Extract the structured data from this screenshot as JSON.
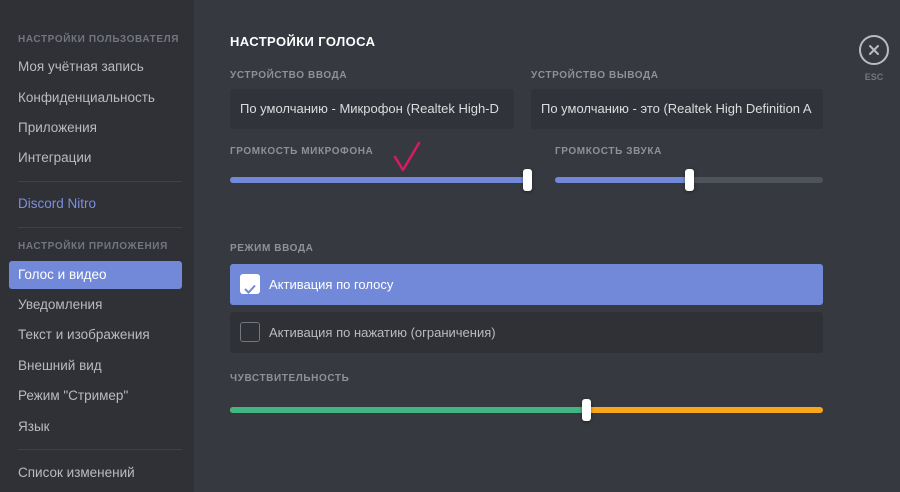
{
  "sidebar": {
    "user_settings_header": "Настройки пользователя",
    "user_items": [
      {
        "label": "Моя учётная запись"
      },
      {
        "label": "Конфиденциальность"
      },
      {
        "label": "Приложения"
      },
      {
        "label": "Интеграции"
      }
    ],
    "nitro_label": "Discord Nitro",
    "app_settings_header": "Настройки приложения",
    "app_items": [
      {
        "label": "Голос и видео",
        "selected": true
      },
      {
        "label": "Уведомления"
      },
      {
        "label": "Текст и изображения"
      },
      {
        "label": "Внешний вид"
      },
      {
        "label": "Режим \"Стример\""
      },
      {
        "label": "Язык"
      }
    ],
    "changelog_label": "Список изменений"
  },
  "voice": {
    "title": "Настройки голоса",
    "input_device": {
      "label": "Устройство ввода",
      "value": "По умолчанию - Микрофон (Realtek High-D"
    },
    "output_device": {
      "label": "Устройство вывода",
      "value": "По умолчанию - это (Realtek High Definition A"
    },
    "input_volume": {
      "label": "Громкость микрофона",
      "value_percent": 100
    },
    "output_volume": {
      "label": "Громкость звука",
      "value_percent": 50
    },
    "input_mode": {
      "label": "Режим ввода",
      "options": [
        {
          "label": "Активация по голосу",
          "checked": true
        },
        {
          "label": "Активация по нажатию (ограничения)",
          "checked": false
        }
      ]
    },
    "sensitivity": {
      "label": "Чувствительность",
      "value_percent": 60
    }
  },
  "close": {
    "esc_label": "ESC"
  },
  "colors": {
    "accent": "#7289da",
    "sensitivity_active": "#43b581",
    "sensitivity_inactive": "#faa61a",
    "annotation": "#d81b60"
  }
}
